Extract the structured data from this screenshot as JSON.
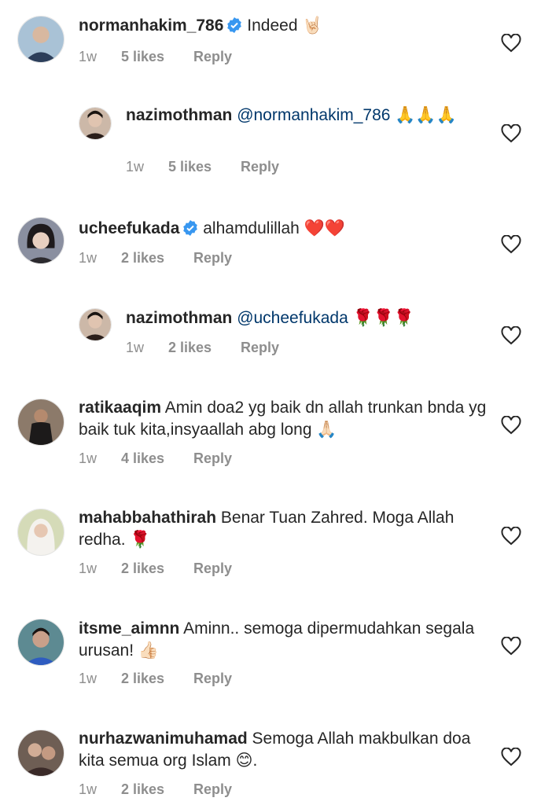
{
  "comments": [
    {
      "username": "normanhakim_786",
      "verified": true,
      "mention": "",
      "text": "Indeed 🤘🏻",
      "time": "1w",
      "likes": "5 likes",
      "reply": "Reply",
      "avatar_color": "#7fa6c4"
    },
    {
      "username": "nazimothman",
      "verified": false,
      "mention": "@normanhakim_786",
      "text": " 🙏🙏🙏",
      "time": "1w",
      "likes": "5 likes",
      "reply": "Reply",
      "avatar_color": "#3a2a24"
    },
    {
      "username": "ucheefukada",
      "verified": true,
      "mention": "",
      "text": "alhamdulillah ❤️❤️",
      "time": "1w",
      "likes": "2 likes",
      "reply": "Reply",
      "avatar_color": "#6b6e7a"
    },
    {
      "username": "nazimothman",
      "verified": false,
      "mention": "@ucheefukada",
      "text": " 🌹🌹🌹",
      "time": "1w",
      "likes": "2 likes",
      "reply": "Reply",
      "avatar_color": "#3a2a24"
    },
    {
      "username": "ratikaaqim",
      "verified": false,
      "mention": "",
      "text": "Amin doa2 yg baik dn allah trunkan bnda yg baik tuk kita,insyaallah abg long 🙏🏻",
      "time": "1w",
      "likes": "4 likes",
      "reply": "Reply",
      "avatar_color": "#4a3f38"
    },
    {
      "username": "mahabbahathirah",
      "verified": false,
      "mention": "",
      "text": "Benar Tuan Zahred. Moga Allah redha. 🌹",
      "time": "1w",
      "likes": "2 likes",
      "reply": "Reply",
      "avatar_color": "#c9cfa8"
    },
    {
      "username": "itsme_aimnn",
      "verified": false,
      "mention": "",
      "text": "Aminn.. semoga dipermudahkan segala urusan! 👍🏻",
      "time": "1w",
      "likes": "2 likes",
      "reply": "Reply",
      "avatar_color": "#3f6b78"
    },
    {
      "username": "nurhazwanimuhamad",
      "verified": false,
      "mention": "",
      "text": "Semoga Allah makbulkan doa kita semua org Islam 😊.",
      "time": "1w",
      "likes": "2 likes",
      "reply": "Reply",
      "avatar_color": "#5a4a42"
    }
  ]
}
